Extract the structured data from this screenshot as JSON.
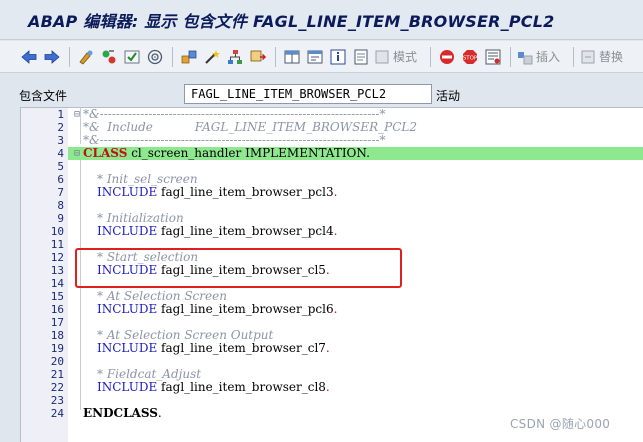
{
  "window": {
    "title": "ABAP 编辑器: 显示 包含文件 FAGL_LINE_ITEM_BROWSER_PCL2"
  },
  "toolbar": {
    "mode_label": "模式",
    "insert_label": "插入",
    "replace_label": "替换"
  },
  "include_field": {
    "label": "包含文件",
    "value": "FAGL_LINE_ITEM_BROWSER_PCL2",
    "status": "活动"
  },
  "code_lines": [
    {
      "num": "1",
      "text": "*&---------------------------------------------------------------------*"
    },
    {
      "num": "2",
      "text": "*&  Include           FAGL_LINE_ITEM_BROWSER_PCL2"
    },
    {
      "num": "3",
      "text": "*&---------------------------------------------------------------------*"
    },
    {
      "num": "4",
      "kw": "CLASS",
      "rest": " cl_screen_handler IMPLEMENTATION."
    },
    {
      "num": "5",
      "text": ""
    },
    {
      "num": "6",
      "text": "* Init_sel_screen"
    },
    {
      "num": "7",
      "kw": "INCLUDE",
      "rest": " fagl_line_item_browser_pcl3",
      "dot": "."
    },
    {
      "num": "8",
      "text": ""
    },
    {
      "num": "9",
      "text": "* Initialization"
    },
    {
      "num": "10",
      "kw": "INCLUDE",
      "rest": " fagl_line_item_browser_pcl4",
      "dot": "."
    },
    {
      "num": "11",
      "text": ""
    },
    {
      "num": "12",
      "text": "* Start_selection"
    },
    {
      "num": "13",
      "kw": "INCLUDE",
      "rest": " fagl_line_item_browser_cl5",
      "dot": "."
    },
    {
      "num": "14",
      "text": ""
    },
    {
      "num": "15",
      "text": "* At Selection Screen"
    },
    {
      "num": "16",
      "kw": "INCLUDE",
      "rest": " fagl_line_item_browser_pcl6",
      "dot": "."
    },
    {
      "num": "17",
      "text": ""
    },
    {
      "num": "18",
      "text": "* At Selection Screen Output"
    },
    {
      "num": "19",
      "kw": "INCLUDE",
      "rest": " fagl_line_item_browser_cl7",
      "dot": "."
    },
    {
      "num": "20",
      "text": ""
    },
    {
      "num": "21",
      "text": "* Fieldcat_Adjust"
    },
    {
      "num": "22",
      "kw": "INCLUDE",
      "rest": " fagl_line_item_browser_cl8",
      "dot": "."
    },
    {
      "num": "23",
      "text": ""
    },
    {
      "num": "24",
      "kw": "ENDCLASS",
      "dot": "."
    }
  ],
  "watermark": "CSDN @随心000",
  "colors": {
    "highlight": "#8ee88e",
    "selection_box": "#e02020",
    "keyword": "#1a1ac0"
  }
}
